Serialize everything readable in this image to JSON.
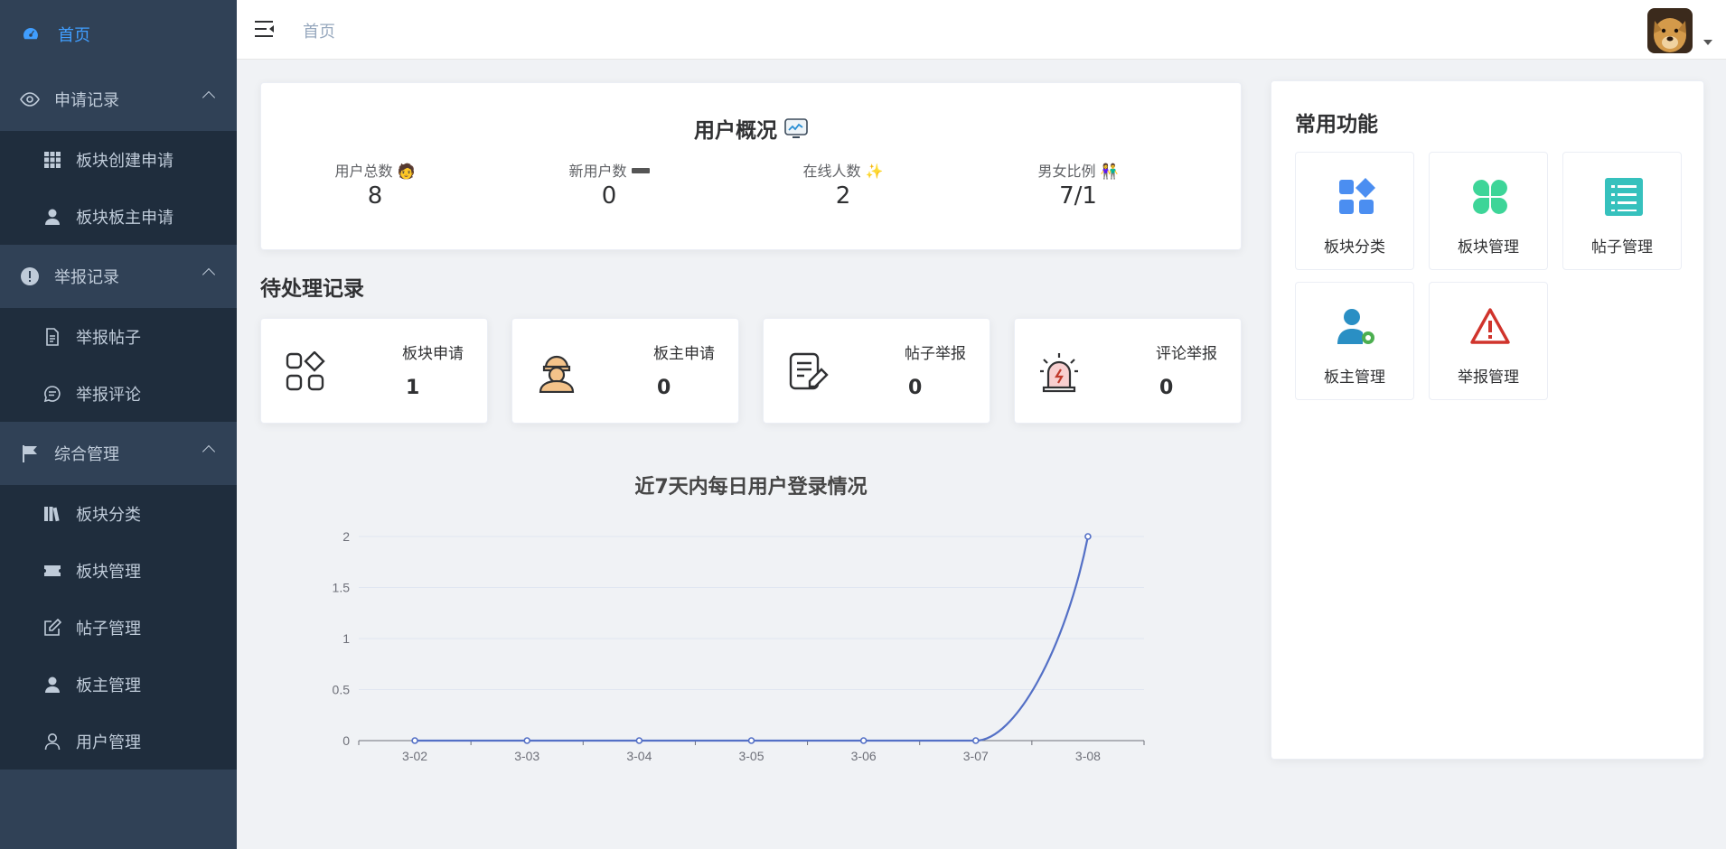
{
  "sidebar": {
    "home": "首页",
    "groups": [
      {
        "label": "申请记录",
        "items": [
          "板块创建申请",
          "板块板主申请"
        ]
      },
      {
        "label": "举报记录",
        "items": [
          "举报帖子",
          "举报评论"
        ]
      },
      {
        "label": "综合管理",
        "items": [
          "板块分类",
          "板块管理",
          "帖子管理",
          "板主管理",
          "用户管理"
        ]
      }
    ]
  },
  "header": {
    "breadcrumb": "首页"
  },
  "overview": {
    "title": "用户概况",
    "stats": [
      {
        "label": "用户总数",
        "value": "8"
      },
      {
        "label": "新用户数",
        "value": "0"
      },
      {
        "label": "在线人数",
        "value": "2"
      },
      {
        "label": "男女比例",
        "value": "7/1"
      }
    ]
  },
  "pending": {
    "title": "待处理记录",
    "cards": [
      {
        "label": "板块申请",
        "value": "1"
      },
      {
        "label": "板主申请",
        "value": "0"
      },
      {
        "label": "帖子举报",
        "value": "0"
      },
      {
        "label": "评论举报",
        "value": "0"
      }
    ]
  },
  "common": {
    "title": "常用功能",
    "tiles": [
      "板块分类",
      "板块管理",
      "帖子管理",
      "板主管理",
      "举报管理"
    ]
  },
  "colors": {
    "accent": "#409eff",
    "sidebar": "#304156",
    "sidebar_sub": "#1f2d3d",
    "series": "#5470c6"
  },
  "chart_data": {
    "type": "line",
    "title": "近7天内每日用户登录情况",
    "categories": [
      "3-02",
      "3-03",
      "3-04",
      "3-05",
      "3-06",
      "3-07",
      "3-08"
    ],
    "values": [
      0,
      0,
      0,
      0,
      0,
      0,
      2
    ],
    "y_ticks": [
      "0",
      "0.5",
      "1",
      "1.5",
      "2"
    ],
    "ylim": [
      0,
      2
    ],
    "smooth": true,
    "grid": "horizontal"
  }
}
